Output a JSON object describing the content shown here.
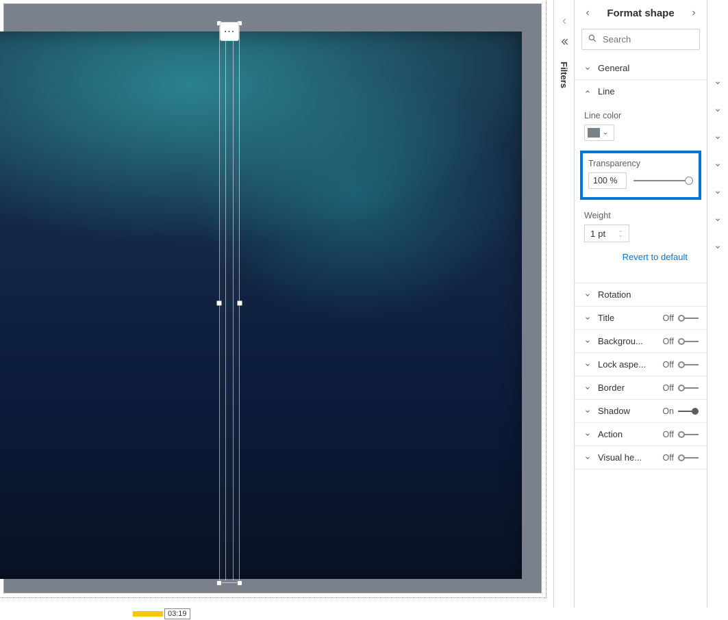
{
  "filters": {
    "label": "Filters"
  },
  "pane": {
    "title": "Format shape",
    "search_placeholder": "Search"
  },
  "sections": {
    "general": "General",
    "line": "Line",
    "line_color_label": "Line color",
    "transparency_label": "Transparency",
    "transparency_value": "100",
    "transparency_unit": "%",
    "weight_label": "Weight",
    "weight_value": "1",
    "weight_unit": "pt",
    "revert": "Revert to default",
    "rotation": "Rotation",
    "title_row": "Title",
    "background": "Backgrou...",
    "lock_aspect": "Lock aspe...",
    "border": "Border",
    "shadow": "Shadow",
    "action": "Action",
    "visual_header": "Visual he..."
  },
  "states": {
    "off": "Off",
    "on": "On"
  },
  "timeline": {
    "timecode": "03:19"
  },
  "colors": {
    "line_color_swatch": "#7b838a"
  }
}
